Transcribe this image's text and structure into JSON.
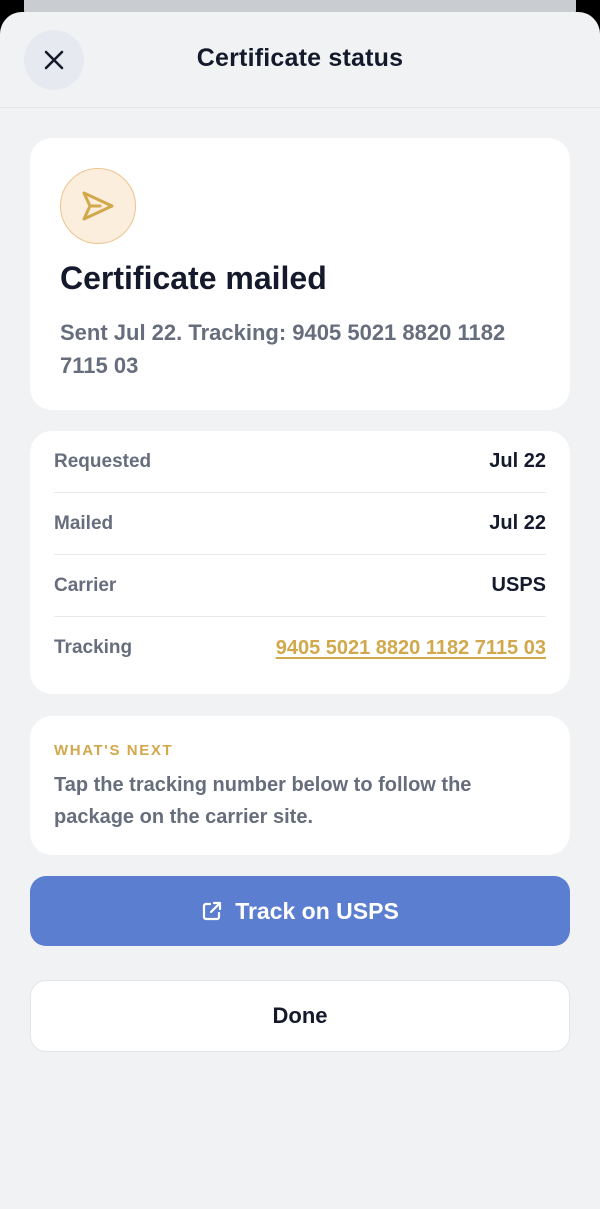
{
  "header": {
    "title": "Certificate status",
    "close_icon": "close-icon"
  },
  "status": {
    "icon": "paper-plane-icon",
    "title": "Certificate mailed",
    "subtitle": "Sent Jul 22. Tracking: 9405 5021 8820 1182 7115 03"
  },
  "details": [
    {
      "label": "Requested",
      "value": "Jul 22"
    },
    {
      "label": "Mailed",
      "value": "Jul 22"
    },
    {
      "label": "Carrier",
      "value": "USPS"
    },
    {
      "label": "Tracking",
      "value": "9405 5021 8820 1182 7115 03"
    }
  ],
  "next": {
    "title": "WHAT'S NEXT",
    "body": "Tap the tracking number below to follow the package on the carrier site."
  },
  "buttons": {
    "track_label": "Track on USPS",
    "track_icon": "external-link-icon",
    "done_label": "Done"
  },
  "colors": {
    "accent_gold": "#d1a84b",
    "primary_blue": "#5b7ed0",
    "background": "#f1f2f4"
  }
}
